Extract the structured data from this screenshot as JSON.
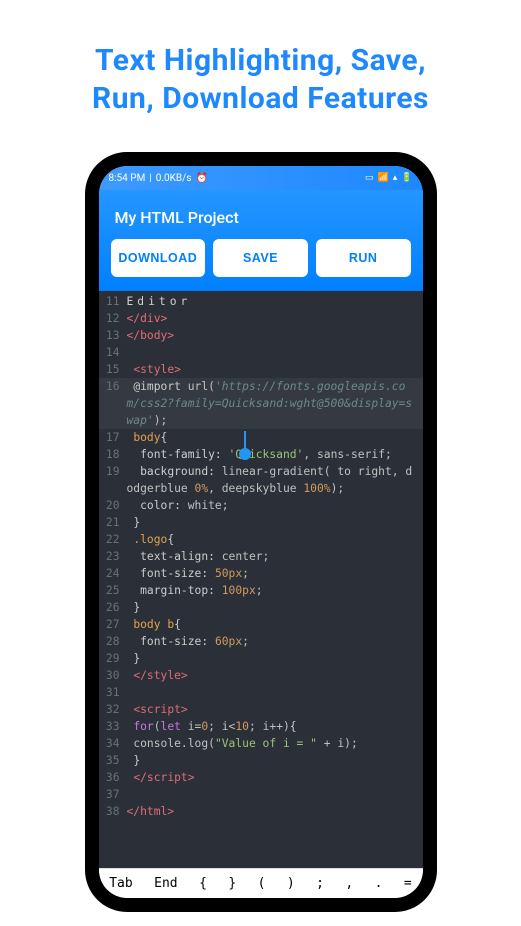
{
  "promo": {
    "line1": "Text Highlighting, Save,",
    "line2": "Run, Download Features"
  },
  "statusbar": {
    "time": "8:54 PM",
    "net": "0.0KB/s"
  },
  "header": {
    "title": "My HTML Project",
    "download": "DOWNLOAD",
    "save": "SAVE",
    "run": "RUN"
  },
  "code": {
    "lines": [
      {
        "n": "11",
        "html": "<span class='t-spaced'>Editor</span>"
      },
      {
        "n": "12",
        "html": "<span class='t-tag'>&lt;/div&gt;</span>"
      },
      {
        "n": "13",
        "html": "<span class='t-tag'>&lt;/body&gt;</span>"
      },
      {
        "n": "14",
        "html": ""
      },
      {
        "n": "15",
        "html": " <span class='t-tag'>&lt;style&gt;</span>"
      },
      {
        "n": "16",
        "hl": true,
        "html": " <span class='t-prop'>@import</span> url(<span class='t-comment'>'https://fonts.googleapis.com/css2?family=Quicksand:wght@500&amp;display=swap'</span>);"
      },
      {
        "n": "17",
        "html": " <span class='t-sel'>body</span><span class='t-punct'>{</span>"
      },
      {
        "n": "18",
        "html": "  <span class='t-prop'>font-family:</span> <span class='t-str'>'Quicksand'</span>, sans-serif;"
      },
      {
        "n": "19",
        "html": "  <span class='t-prop'>background:</span> linear-gradient( to right, dodgerblue <span class='t-num'>0%</span>, deepskyblue <span class='t-num'>100%</span>);"
      },
      {
        "n": "20",
        "html": "  <span class='t-prop'>color:</span> white;"
      },
      {
        "n": "21",
        "html": " <span class='t-punct'>}</span>"
      },
      {
        "n": "22",
        "html": " <span class='t-sel'>.logo</span><span class='t-punct'>{</span>"
      },
      {
        "n": "23",
        "html": "  <span class='t-prop'>text-align:</span> center;"
      },
      {
        "n": "24",
        "html": "  <span class='t-prop'>font-size:</span> <span class='t-num'>50px</span>;"
      },
      {
        "n": "25",
        "html": "  <span class='t-prop'>margin-top:</span> <span class='t-num'>100px</span>;"
      },
      {
        "n": "26",
        "html": " <span class='t-punct'>}</span>"
      },
      {
        "n": "27",
        "html": " <span class='t-sel'>body b</span><span class='t-punct'>{</span>"
      },
      {
        "n": "28",
        "html": "  <span class='t-prop'>font-size:</span> <span class='t-num'>60px</span>;"
      },
      {
        "n": "29",
        "html": " <span class='t-punct'>}</span>"
      },
      {
        "n": "30",
        "html": " <span class='t-tag'>&lt;/style&gt;</span>"
      },
      {
        "n": "31",
        "html": ""
      },
      {
        "n": "32",
        "html": " <span class='t-tag'>&lt;script&gt;</span>"
      },
      {
        "n": "33",
        "html": " <span class='t-kw'>for</span>(<span class='t-kw'>let</span> i=<span class='t-num'>0</span>; i&lt;<span class='t-num'>10</span>; i++)<span class='t-punct'>{</span>"
      },
      {
        "n": "34",
        "html": " console.log(<span class='t-str'>\"Value of i = \"</span> + i);"
      },
      {
        "n": "35",
        "html": " <span class='t-punct'>}</span>"
      },
      {
        "n": "36",
        "html": " <span class='t-tag'>&lt;/script&gt;</span>"
      },
      {
        "n": "37",
        "html": ""
      },
      {
        "n": "38",
        "html": "<span class='t-tag'>&lt;/html&gt;</span>"
      }
    ]
  },
  "keyrow": [
    "Tab",
    "End",
    "{",
    "}",
    "(",
    ")",
    ";",
    ",",
    ".",
    "="
  ]
}
